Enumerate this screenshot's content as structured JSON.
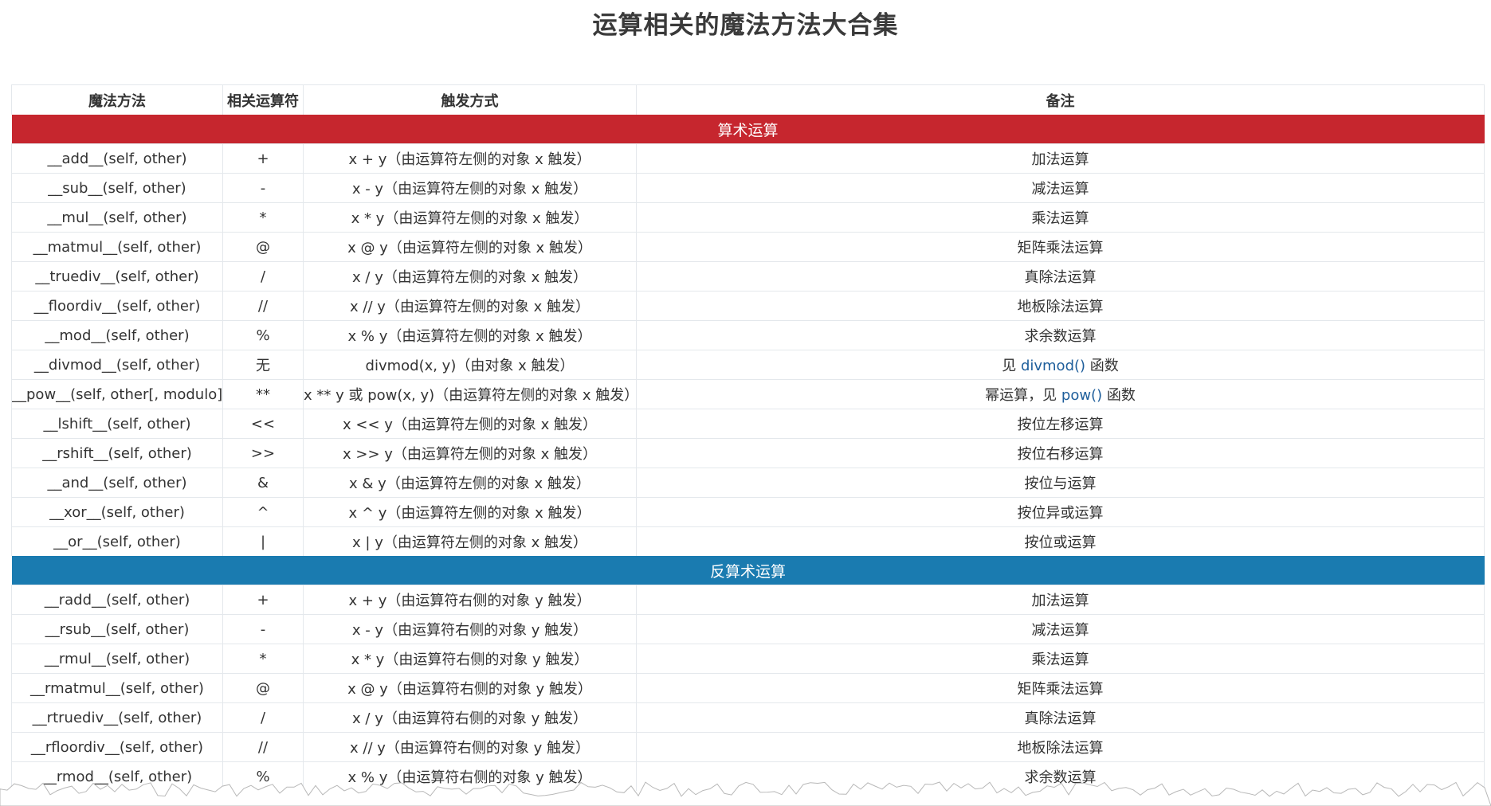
{
  "title": "运算相关的魔法方法大合集",
  "headers": [
    "魔法方法",
    "相关运算符",
    "触发方式",
    "备注"
  ],
  "sections": [
    {
      "label": "算术运算",
      "color": "#c6262e",
      "rows": [
        {
          "method": "__add__(self, other)",
          "op": "+",
          "trigger": "x + y（由运算符左侧的对象 x 触发）",
          "note": "加法运算"
        },
        {
          "method": "__sub__(self, other)",
          "op": "-",
          "trigger": "x - y（由运算符左侧的对象 x 触发）",
          "note": "减法运算"
        },
        {
          "method": "__mul__(self, other)",
          "op": "*",
          "trigger": "x * y（由运算符左侧的对象 x 触发）",
          "note": "乘法运算"
        },
        {
          "method": "__matmul__(self, other)",
          "op": "@",
          "trigger": "x @ y（由运算符左侧的对象 x 触发）",
          "note": "矩阵乘法运算"
        },
        {
          "method": "__truediv__(self, other)",
          "op": "/",
          "trigger": "x / y（由运算符左侧的对象 x 触发）",
          "note": "真除法运算"
        },
        {
          "method": "__floordiv__(self, other)",
          "op": "//",
          "trigger": "x // y（由运算符左侧的对象 x 触发）",
          "note": "地板除法运算"
        },
        {
          "method": "__mod__(self, other)",
          "op": "%",
          "trigger": "x % y（由运算符左侧的对象 x 触发）",
          "note": "求余数运算"
        },
        {
          "method": "__divmod__(self, other)",
          "op": "无",
          "trigger": "divmod(x, y)（由对象 x 触发）",
          "note_pre": "见 ",
          "note_link": "divmod()",
          "note_post": " 函数"
        },
        {
          "method": "__pow__(self, other[, modulo])",
          "op": "**",
          "trigger": "x ** y 或 pow(x, y)（由运算符左侧的对象 x 触发）",
          "note_pre": "幂运算，见 ",
          "note_link": "pow()",
          "note_post": " 函数"
        },
        {
          "method": "__lshift__(self, other)",
          "op": "<<",
          "trigger": "x << y（由运算符左侧的对象 x 触发）",
          "note": "按位左移运算"
        },
        {
          "method": "__rshift__(self, other)",
          "op": ">>",
          "trigger": "x >> y（由运算符左侧的对象 x 触发）",
          "note": "按位右移运算"
        },
        {
          "method": "__and__(self, other)",
          "op": "&",
          "trigger": "x & y（由运算符左侧的对象 x 触发）",
          "note": "按位与运算"
        },
        {
          "method": "__xor__(self, other)",
          "op": "^",
          "trigger": "x ^ y（由运算符左侧的对象 x 触发）",
          "note": "按位异或运算"
        },
        {
          "method": "__or__(self, other)",
          "op": "|",
          "trigger": "x | y（由运算符左侧的对象 x 触发）",
          "note": "按位或运算"
        }
      ]
    },
    {
      "label": "反算术运算",
      "color": "#1a7bb0",
      "rows": [
        {
          "method": "__radd__(self, other)",
          "op": "+",
          "trigger": "x + y（由运算符右侧的对象 y 触发）",
          "note": "加法运算"
        },
        {
          "method": "__rsub__(self, other)",
          "op": "-",
          "trigger": "x - y（由运算符右侧的对象 y 触发）",
          "note": "减法运算"
        },
        {
          "method": "__rmul__(self, other)",
          "op": "*",
          "trigger": "x * y（由运算符右侧的对象 y 触发）",
          "note": "乘法运算"
        },
        {
          "method": "__rmatmul__(self, other)",
          "op": "@",
          "trigger": "x @ y（由运算符右侧的对象 y 触发）",
          "note": "矩阵乘法运算"
        },
        {
          "method": "__rtruediv__(self, other)",
          "op": "/",
          "trigger": "x / y（由运算符右侧的对象 y 触发）",
          "note": "真除法运算"
        },
        {
          "method": "__rfloordiv__(self, other)",
          "op": "//",
          "trigger": "x // y（由运算符右侧的对象 y 触发）",
          "note": "地板除法运算"
        },
        {
          "method": "__rmod__(self, other)",
          "op": "%",
          "trigger": "x % y（由运算符右侧的对象 y 触发）",
          "note": "求余数运算"
        }
      ]
    }
  ]
}
